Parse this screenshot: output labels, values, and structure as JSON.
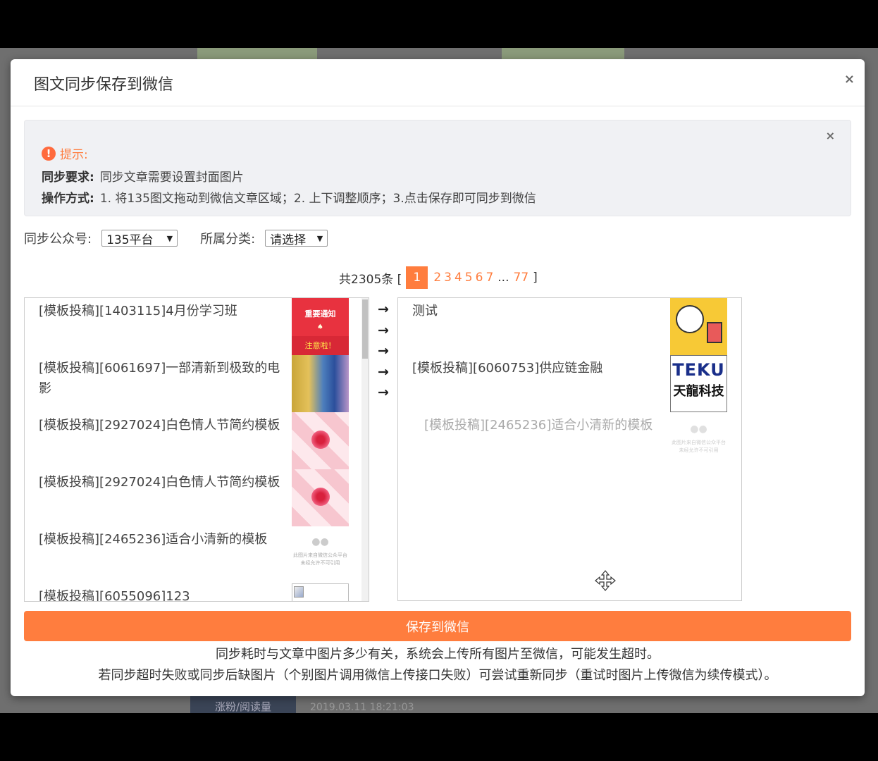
{
  "modal": {
    "title": "图文同步保存到微信",
    "close_label": "×"
  },
  "alert": {
    "close_label": "×",
    "title": "提示:",
    "req_label": "同步要求:",
    "req_text": "同步文章需要设置封面图片",
    "op_label": "操作方式:",
    "op_text": "1. 将135图文拖动到微信文章区域；2. 上下调整顺序；3.点击保存即可同步到微信"
  },
  "filters": {
    "account_label": "同步公众号:",
    "account_value": "135平台",
    "category_label": "所属分类:",
    "category_value": "请选择"
  },
  "pager": {
    "total": "共2305条 [",
    "active": "1",
    "pages": [
      "2",
      "3",
      "4",
      "5",
      "6",
      "7"
    ],
    "ellipsis": "...",
    "last": "77",
    "close": "]"
  },
  "left_list": [
    {
      "title": "[模板投稿][1403115]4月份学习班",
      "thumb": "notice"
    },
    {
      "title": "[模板投稿][6061697]一部清新到极致的电影",
      "thumb": "film"
    },
    {
      "title": "[模板投稿][2927024]白色情人节简约模板",
      "thumb": "roses"
    },
    {
      "title": "[模板投稿][2927024]白色情人节简约模板",
      "thumb": "roses"
    },
    {
      "title": "[模板投稿][2465236]适合小清新的模板",
      "thumb": "wechat-placeholder"
    },
    {
      "title": "[模板投稿][6055096]123",
      "thumb": "broken-image"
    }
  ],
  "thumb_text": {
    "notice_line1": "重要通知",
    "notice_line2": "注意啦！",
    "placeholder_line1": "此图片来自微信公众平台",
    "placeholder_line2": "未经允许不可引用"
  },
  "right_list": [
    {
      "title": "测试",
      "thumb": "cartoon"
    },
    {
      "title": "[模板投稿][6060753]供应链金融",
      "thumb": "teku-logo"
    }
  ],
  "dragging_item": {
    "title": "[模板投稿][2465236]适合小清新的模板"
  },
  "logo": {
    "line1": "TEKU",
    "line2": "天龍科技"
  },
  "arrow_icons": [
    "→",
    "→",
    "→",
    "→",
    "→"
  ],
  "save_button": "保存到微信",
  "notes": [
    "同步耗时与文章中图片多少有关，系统会上传所有图片至微信，可能发生超时。",
    "若同步超时失败或同步后缺图片（个别图片调用微信上传接口失败）可尝试重新同步（重试时图片上传微信为续传模式）。"
  ],
  "background": {
    "bar_label": "涨粉/阅读量",
    "timestamp": "2019.03.11 18:21:03"
  },
  "colors": {
    "accent": "#ff7d3e",
    "notice_red": "#e8323f"
  }
}
